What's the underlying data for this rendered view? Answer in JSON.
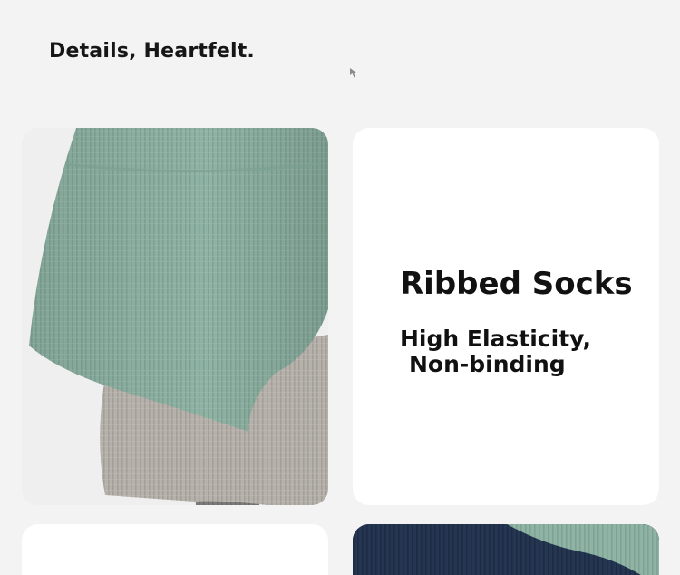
{
  "header": {
    "title": "Details, Heartfelt."
  },
  "product": {
    "name": "Ribbed Socks",
    "feature_line_1": "High Elasticity,",
    "feature_line_2": "Non-binding"
  },
  "colors": {
    "background": "#f3f3f3",
    "card": "#ffffff",
    "sock_green": "#8fb2a4",
    "sock_grey": "#b3aea8",
    "sock_navy": "#243550",
    "text": "#111111"
  }
}
